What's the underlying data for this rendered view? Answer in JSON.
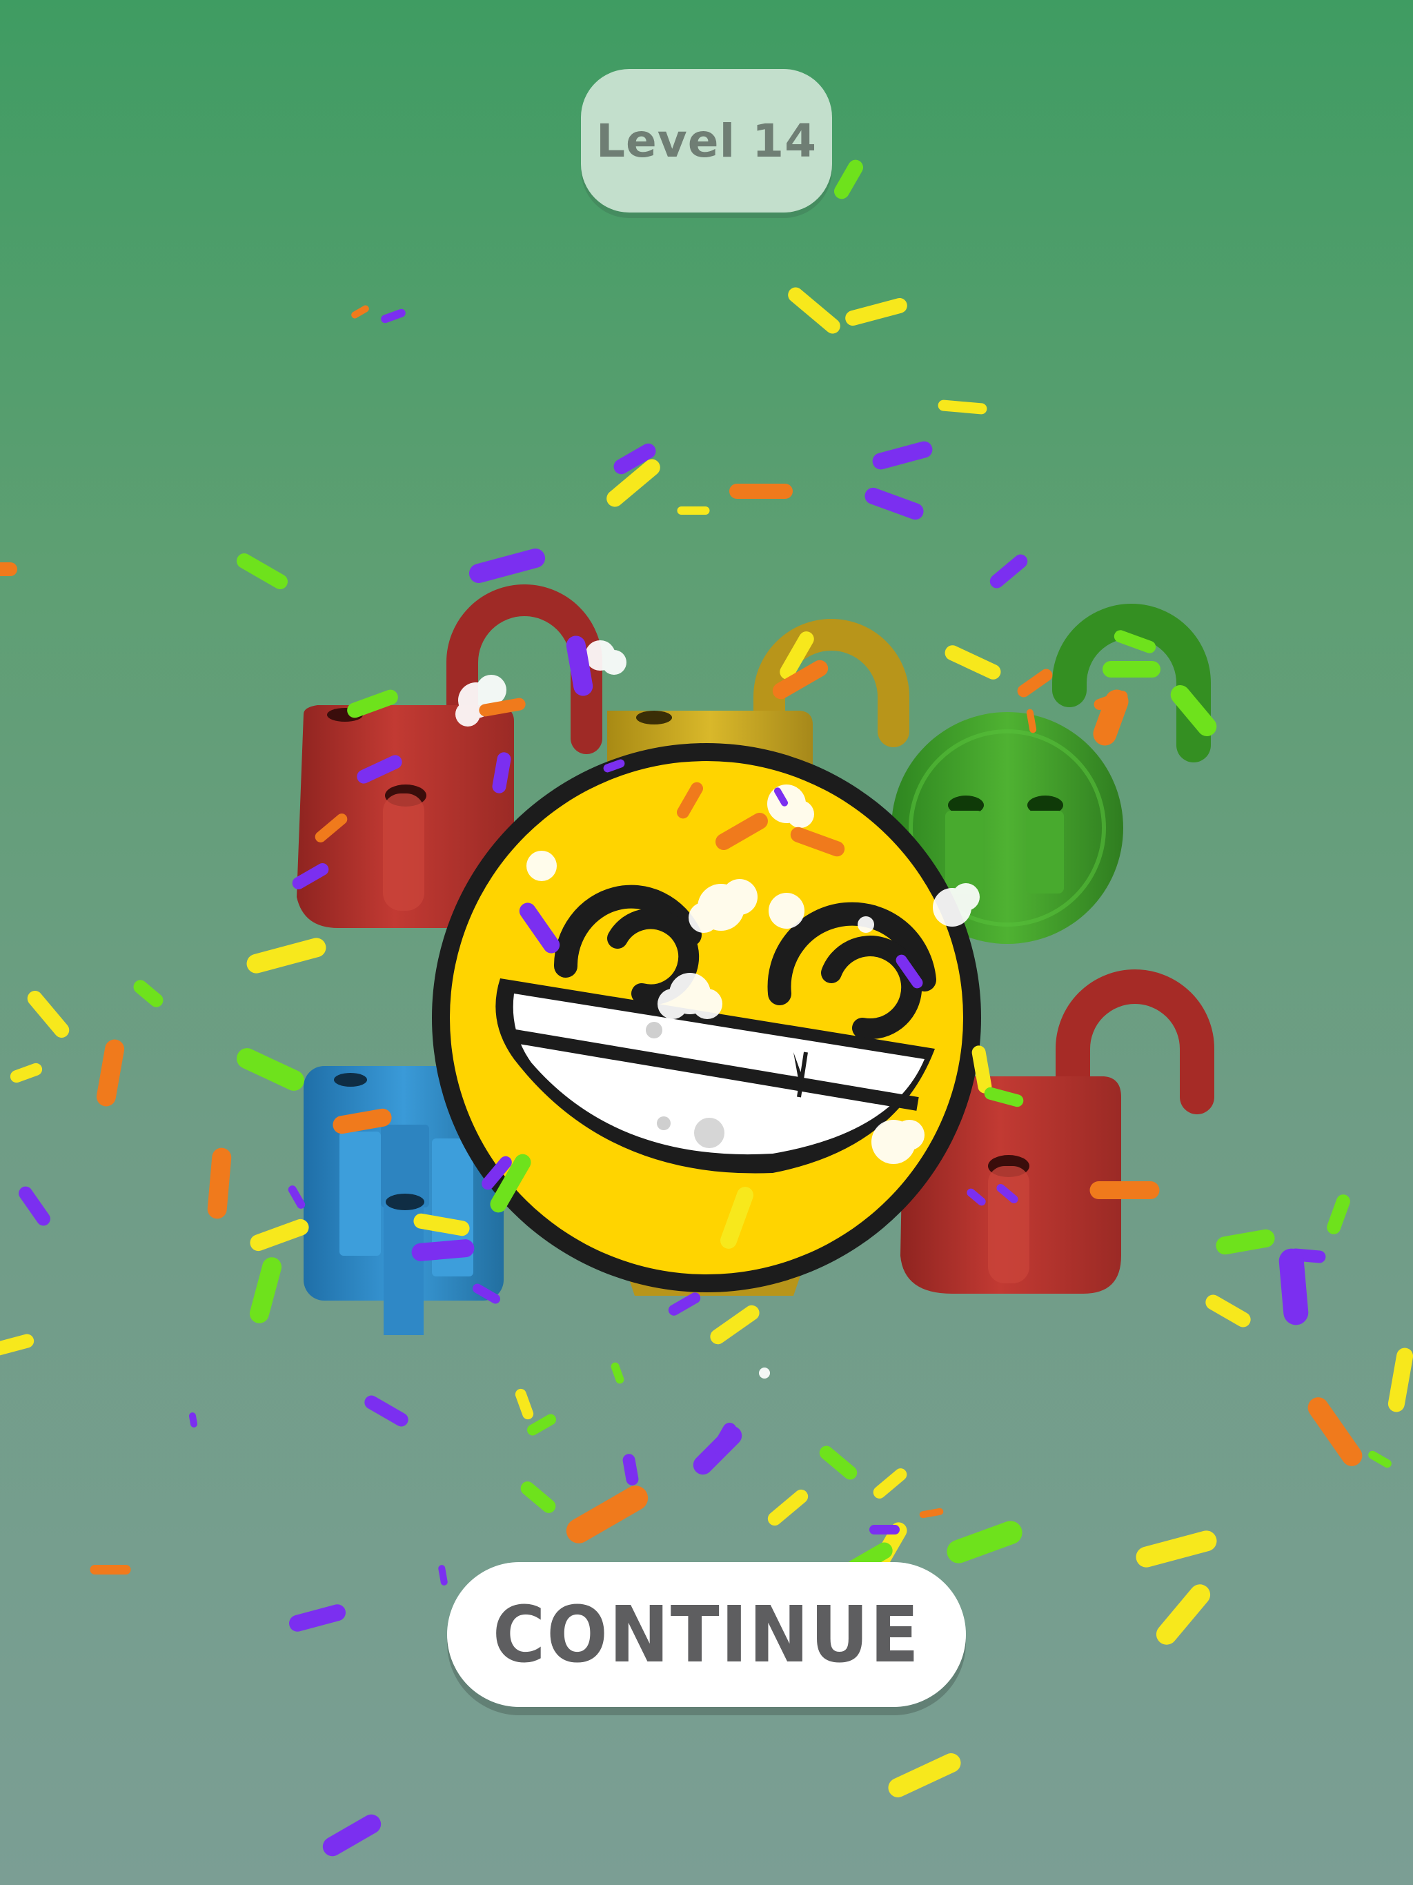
{
  "level": {
    "label": "Level 14"
  },
  "continue_button": {
    "label": "CONTINUE"
  },
  "colors": {
    "background_top": "#3f9c62",
    "background_bottom": "#7b9e94",
    "lock_red": "#b8332e",
    "lock_yellow": "#c9a71c",
    "lock_green": "#3f9e2c",
    "lock_blue": "#2f8fcf",
    "emoji_yellow": "#ffd400",
    "confetti": [
      "#f7e81c",
      "#7b2ff0",
      "#f07a1c",
      "#6ee21c"
    ]
  },
  "scene": {
    "padlocks": [
      {
        "color": "red",
        "state": "open"
      },
      {
        "color": "yellow",
        "state": "open"
      },
      {
        "color": "green",
        "state": "open"
      },
      {
        "color": "blue",
        "state": "open"
      },
      {
        "color": "red",
        "state": "open"
      }
    ],
    "emoji": "grinning-face",
    "effect": "confetti"
  }
}
